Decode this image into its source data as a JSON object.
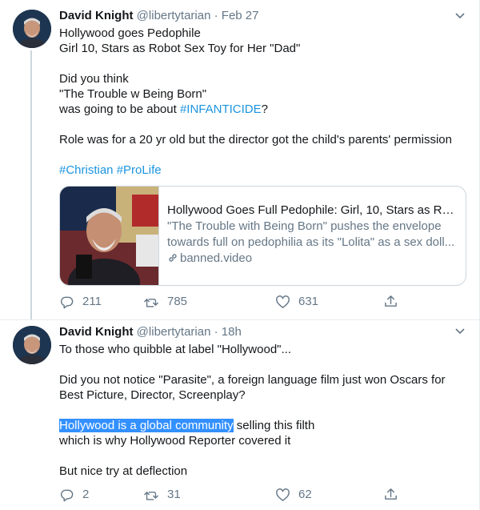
{
  "tweets": [
    {
      "author_name": "David Knight",
      "handle": "@libertytarian",
      "separator": "·",
      "time": "Feb 27",
      "lines": {
        "l1": "Hollywood goes Pedophile",
        "l2": "Girl 10, Stars as Robot Sex Toy for Her \"Dad\"",
        "l3": "Did you think",
        "l4": "\"The Trouble w Being Born\"",
        "l5_prefix": "was going to be about ",
        "l5_link": "#INFANTICIDE",
        "l5_suffix": "?",
        "l6": "Role was for a 20 yr old but the director got the child's parents' permission",
        "hashtag1": "#Christian",
        "hashtag2": "#ProLife"
      },
      "card": {
        "title": "Hollywood Goes Full Pedophile: Girl, 10, Stars as Rob...",
        "description": "\"The Trouble with Being Born\" pushes the envelope towards full on pedophilia as its \"Lolita\" as a sex doll...",
        "domain": "banned.video"
      },
      "replies": "211",
      "retweets": "785",
      "likes": "631"
    },
    {
      "author_name": "David Knight",
      "handle": "@libertytarian",
      "separator": "·",
      "time": "18h",
      "lines": {
        "l1": "To those who quibble at label \"Hollywood\"...",
        "l2": "Did you not notice \"Parasite\", a foreign language film just won Oscars for",
        "l3": "Best Picture, Director, Screenplay?",
        "l4_selected": "Hollywood is a global community",
        "l4_rest": " selling this filth",
        "l5": "which is why Hollywood Reporter covered it",
        "l6": "But nice try at deflection"
      },
      "replies": "2",
      "retweets": "31",
      "likes": "62"
    }
  ],
  "colors": {
    "link": "#1b95e0",
    "secondary_text": "#657786",
    "selection": "#3390ff",
    "border": "#e6ecf0"
  },
  "icons": [
    "chevron-down-icon",
    "reply-icon",
    "retweet-icon",
    "like-icon",
    "share-icon",
    "link-icon"
  ]
}
